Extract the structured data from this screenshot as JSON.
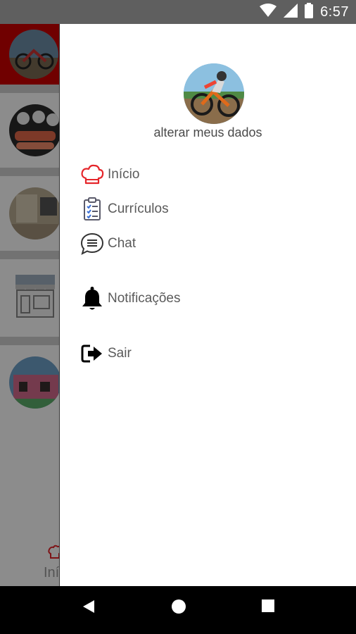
{
  "status_bar": {
    "time": "6:57"
  },
  "background": {
    "bottom_tab_label": "Iní"
  },
  "drawer": {
    "profile_label": "alterar meus dados",
    "menu": [
      {
        "label": "Início",
        "icon": "chef-hat-icon"
      },
      {
        "label": "Currículos",
        "icon": "clipboard-checklist-icon"
      },
      {
        "label": "Chat",
        "icon": "chat-bubble-icon"
      },
      {
        "label": "Notificações",
        "icon": "bell-icon"
      },
      {
        "label": "Sair",
        "icon": "exit-icon"
      }
    ]
  },
  "colors": {
    "accent": "#e5262b",
    "status_bar": "#5f5f5f",
    "nav_bar": "#000000"
  }
}
